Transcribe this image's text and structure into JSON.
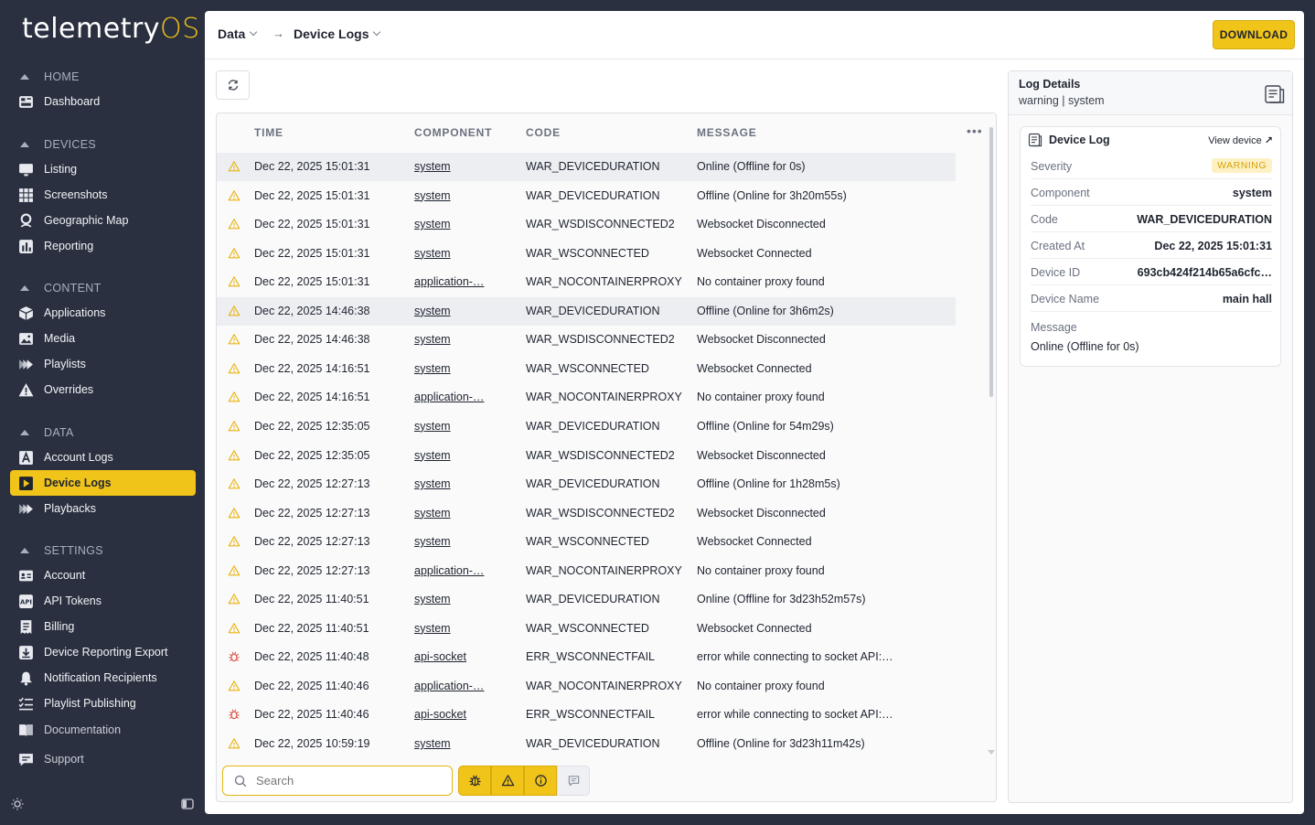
{
  "sidebar": {
    "logo_main": "telemetry",
    "logo_accent": "OS",
    "sections": [
      {
        "title": "HOME",
        "items": [
          {
            "label": "Dashboard",
            "icon": "dashboard-icon"
          }
        ]
      },
      {
        "title": "DEVICES",
        "items": [
          {
            "label": "Listing",
            "icon": "monitor-icon"
          },
          {
            "label": "Screenshots",
            "icon": "grid-icon"
          },
          {
            "label": "Geographic Map",
            "icon": "map-pin-icon"
          },
          {
            "label": "Reporting",
            "icon": "bar-chart-icon"
          }
        ]
      },
      {
        "title": "CONTENT",
        "items": [
          {
            "label": "Applications",
            "icon": "box-icon"
          },
          {
            "label": "Media",
            "icon": "image-icon"
          },
          {
            "label": "Playlists",
            "icon": "playlist-icon"
          },
          {
            "label": "Overrides",
            "icon": "alert-triangle-icon"
          }
        ]
      },
      {
        "title": "DATA",
        "items": [
          {
            "label": "Account Logs",
            "icon": "account-log-icon"
          },
          {
            "label": "Device Logs",
            "icon": "device-log-icon",
            "active": true
          },
          {
            "label": "Playbacks",
            "icon": "playback-icon"
          }
        ]
      },
      {
        "title": "SETTINGS",
        "items": [
          {
            "label": "Account",
            "icon": "id-card-icon"
          },
          {
            "label": "API Tokens",
            "icon": "api-icon"
          },
          {
            "label": "Billing",
            "icon": "receipt-icon"
          },
          {
            "label": "Device Reporting Export",
            "icon": "download-box-icon"
          },
          {
            "label": "Notification Recipients",
            "icon": "bell-icon"
          },
          {
            "label": "Playlist Publishing",
            "icon": "list-check-icon"
          }
        ]
      }
    ],
    "footer_items": [
      {
        "label": "Documentation",
        "icon": "book-icon"
      },
      {
        "label": "Support",
        "icon": "chat-icon"
      }
    ]
  },
  "header": {
    "crumb_parent": "Data",
    "crumb_current": "Device Logs",
    "download_label": "DOWNLOAD"
  },
  "table": {
    "columns": [
      "TIME",
      "COMPONENT",
      "CODE",
      "MESSAGE"
    ],
    "rows": [
      {
        "level": "warning",
        "time": "Dec 22, 2025 15:01:31",
        "component": "system",
        "code": "WAR_DEVICEDURATION",
        "message": "Online (Offline for 0s)",
        "highlight": true
      },
      {
        "level": "warning",
        "time": "Dec 22, 2025 15:01:31",
        "component": "system",
        "code": "WAR_DEVICEDURATION",
        "message": "Offline (Online for 3h20m55s)"
      },
      {
        "level": "warning",
        "time": "Dec 22, 2025 15:01:31",
        "component": "system",
        "code": "WAR_WSDISCONNECTED2",
        "message": "Websocket Disconnected"
      },
      {
        "level": "warning",
        "time": "Dec 22, 2025 15:01:31",
        "component": "system",
        "code": "WAR_WSCONNECTED",
        "message": "Websocket Connected"
      },
      {
        "level": "warning",
        "time": "Dec 22, 2025 15:01:31",
        "component": "application-…",
        "code": "WAR_NOCONTAINERPROXY",
        "message": "No container proxy found"
      },
      {
        "level": "warning",
        "time": "Dec 22, 2025 14:46:38",
        "component": "system",
        "code": "WAR_DEVICEDURATION",
        "message": "Offline (Online for 3h6m2s)",
        "highlight": true
      },
      {
        "level": "warning",
        "time": "Dec 22, 2025 14:46:38",
        "component": "system",
        "code": "WAR_WSDISCONNECTED2",
        "message": "Websocket Disconnected"
      },
      {
        "level": "warning",
        "time": "Dec 22, 2025 14:16:51",
        "component": "system",
        "code": "WAR_WSCONNECTED",
        "message": "Websocket Connected"
      },
      {
        "level": "warning",
        "time": "Dec 22, 2025 14:16:51",
        "component": "application-…",
        "code": "WAR_NOCONTAINERPROXY",
        "message": "No container proxy found"
      },
      {
        "level": "warning",
        "time": "Dec 22, 2025 12:35:05",
        "component": "system",
        "code": "WAR_DEVICEDURATION",
        "message": "Offline (Online for 54m29s)"
      },
      {
        "level": "warning",
        "time": "Dec 22, 2025 12:35:05",
        "component": "system",
        "code": "WAR_WSDISCONNECTED2",
        "message": "Websocket Disconnected"
      },
      {
        "level": "warning",
        "time": "Dec 22, 2025 12:27:13",
        "component": "system",
        "code": "WAR_DEVICEDURATION",
        "message": "Offline (Online for 1h28m5s)"
      },
      {
        "level": "warning",
        "time": "Dec 22, 2025 12:27:13",
        "component": "system",
        "code": "WAR_WSDISCONNECTED2",
        "message": "Websocket Disconnected"
      },
      {
        "level": "warning",
        "time": "Dec 22, 2025 12:27:13",
        "component": "system",
        "code": "WAR_WSCONNECTED",
        "message": "Websocket Connected"
      },
      {
        "level": "warning",
        "time": "Dec 22, 2025 12:27:13",
        "component": "application-…",
        "code": "WAR_NOCONTAINERPROXY",
        "message": "No container proxy found"
      },
      {
        "level": "warning",
        "time": "Dec 22, 2025 11:40:51",
        "component": "system",
        "code": "WAR_DEVICEDURATION",
        "message": "Online (Offline for 3d23h52m57s)"
      },
      {
        "level": "warning",
        "time": "Dec 22, 2025 11:40:51",
        "component": "system",
        "code": "WAR_WSCONNECTED",
        "message": "Websocket Connected"
      },
      {
        "level": "error",
        "time": "Dec 22, 2025 11:40:48",
        "component": "api-socket",
        "code": "ERR_WSCONNECTFAIL",
        "message": "error while connecting to socket API:…"
      },
      {
        "level": "warning",
        "time": "Dec 22, 2025 11:40:46",
        "component": "application-…",
        "code": "WAR_NOCONTAINERPROXY",
        "message": "No container proxy found"
      },
      {
        "level": "error",
        "time": "Dec 22, 2025 11:40:46",
        "component": "api-socket",
        "code": "ERR_WSCONNECTFAIL",
        "message": "error while connecting to socket API:…"
      },
      {
        "level": "warning",
        "time": "Dec 22, 2025 10:59:19",
        "component": "system",
        "code": "WAR_DEVICEDURATION",
        "message": "Offline (Online for 3d23h11m42s)"
      }
    ]
  },
  "search": {
    "placeholder": "Search"
  },
  "details": {
    "title": "Log Details",
    "subtitle": "warning | system",
    "card_title": "Device Log",
    "view_device": "View device",
    "fields": [
      {
        "key": "Severity",
        "value": "WARNING",
        "badge": true
      },
      {
        "key": "Component",
        "value": "system"
      },
      {
        "key": "Code",
        "value": "WAR_DEVICEDURATION"
      },
      {
        "key": "Created At",
        "value": "Dec 22, 2025 15:01:31"
      },
      {
        "key": "Device ID",
        "value": "693cb424f214b65a6cfc…"
      },
      {
        "key": "Device Name",
        "value": "main hall"
      }
    ],
    "message_label": "Message",
    "message_value": "Online (Offline for 0s)"
  },
  "colors": {
    "accent": "#f0c419",
    "sidebar_bg": "#2a3040",
    "warning": "#e8b20e",
    "error": "#d9453a"
  }
}
